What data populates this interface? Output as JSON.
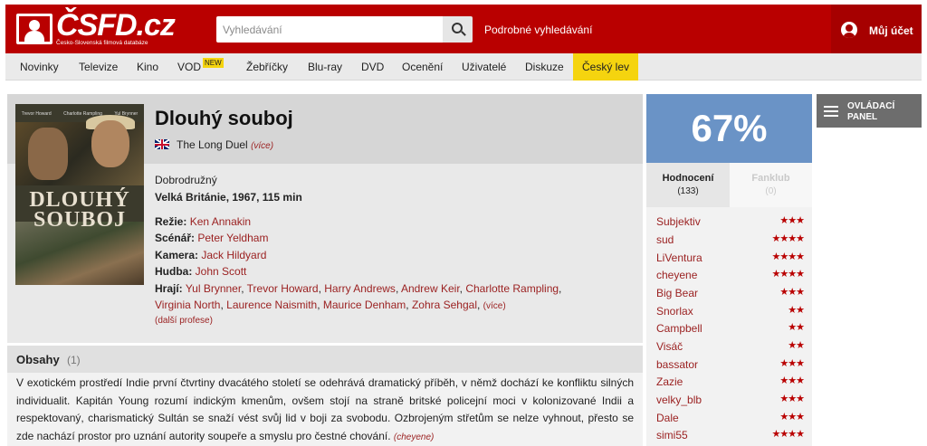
{
  "header": {
    "logo_text": "ČSFD.cz",
    "logo_subtitle": "Česko-Slovenská filmová databáze",
    "search_placeholder": "Vyhledávání",
    "advanced_search": "Podrobné vyhledávání",
    "account_label": "Můj účet",
    "brand_color": "#b90000"
  },
  "nav": {
    "items": [
      "Novinky",
      "Televize",
      "Kino",
      "VOD",
      "Žebříčky",
      "Blu-ray",
      "DVD",
      "Ocenění",
      "Uživatelé",
      "Diskuze",
      "Český lev"
    ],
    "vod_badge": "NEW"
  },
  "film": {
    "poster_names": [
      "Trevor Howard",
      "Charlotte Rampling",
      "Yul Brynner"
    ],
    "poster_title_line1": "DLOUHÝ",
    "poster_title_line2": "SOUBOJ",
    "title": "Dlouhý souboj",
    "original_title": "The Long Duel",
    "original_more": "(více)",
    "genre": "Dobrodružný",
    "origin": "Velká Británie, 1967, 115 min",
    "credits": {
      "directing_label": "Režie:",
      "directing": "Ken Annakin",
      "screenplay_label": "Scénář:",
      "screenplay": "Peter Yeldham",
      "camera_label": "Kamera:",
      "camera": "Jack Hildyard",
      "music_label": "Hudba:",
      "music": "John Scott",
      "cast_label": "Hrají:",
      "cast": [
        "Yul Brynner",
        "Trevor Howard",
        "Harry Andrews",
        "Andrew Keir",
        "Charlotte Rampling",
        "Virginia North",
        "Laurence Naismith",
        "Maurice Denham",
        "Zohra Sehgal"
      ],
      "cast_more": "(více)"
    },
    "more_professions": "(další profese)"
  },
  "plot": {
    "heading": "Obsahy",
    "count": "(1)",
    "text": "V exotickém prostředí Indie první čtvrtiny dvacátého století se odehrává dramatický příběh, v němž dochází ke konfliktu silných individualit. Kapitán Young rozumí indickým kmenům, ovšem stojí na straně britské policejní moci v kolonizované Indii a respektovaný, charismatický Sultán se snaží vést svůj lid v boji za svobodu. Ozbrojeným střetům se nelze vyhnout, přesto se zde nachází prostor pro uznání autority soupeře a smyslu pro čestné chování.",
    "author": "(cheyene)"
  },
  "rating": {
    "percent": "67%",
    "color": "#6a93c6",
    "tab_ratings": "Hodnocení",
    "tab_ratings_count": "(133)",
    "tab_fanclub": "Fanklub",
    "tab_fanclub_count": "(0)",
    "users": [
      {
        "name": "Subjektiv",
        "stars": "★★★"
      },
      {
        "name": "sud",
        "stars": "★★★★"
      },
      {
        "name": "LiVentura",
        "stars": "★★★★"
      },
      {
        "name": "cheyene",
        "stars": "★★★★"
      },
      {
        "name": "Big Bear",
        "stars": "★★★"
      },
      {
        "name": "Snorlax",
        "stars": "★★"
      },
      {
        "name": "Campbell",
        "stars": "★★"
      },
      {
        "name": "Visáč",
        "stars": "★★"
      },
      {
        "name": "bassator",
        "stars": "★★★"
      },
      {
        "name": "Zazie",
        "stars": "★★★"
      },
      {
        "name": "velky_blb",
        "stars": "★★★"
      },
      {
        "name": "Dale",
        "stars": "★★★"
      },
      {
        "name": "simi55",
        "stars": "★★★★"
      }
    ]
  },
  "control_panel": {
    "label": "OVLÁDACÍ PANEL"
  }
}
